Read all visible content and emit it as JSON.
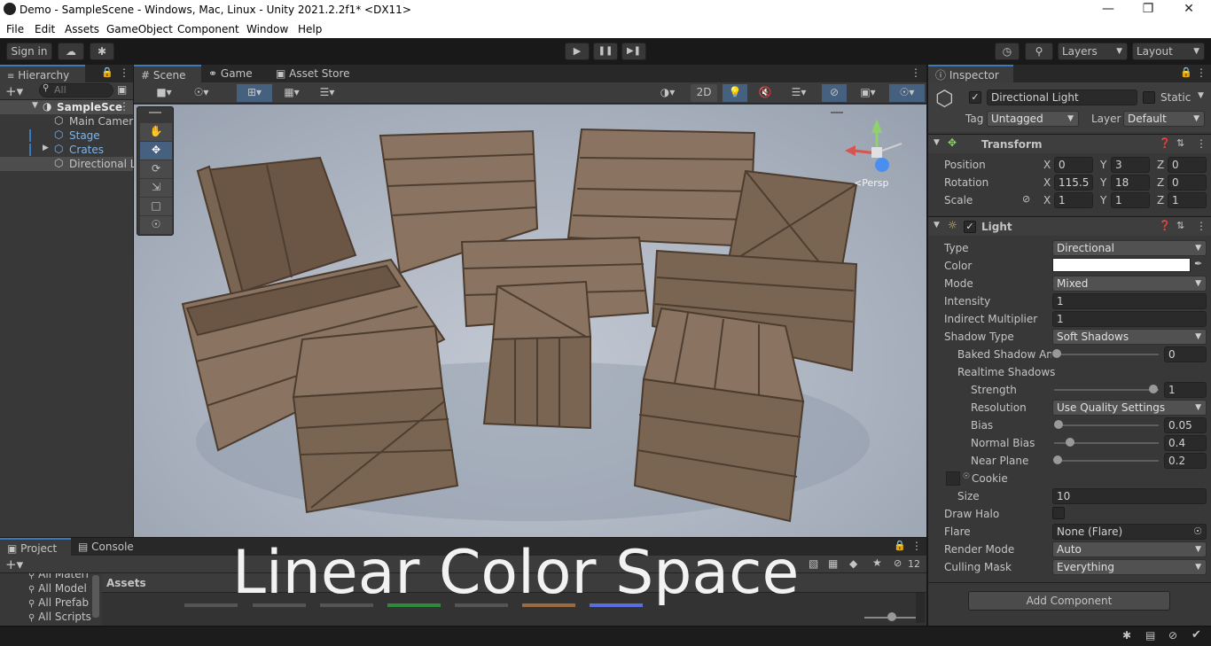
{
  "window": {
    "title": "Demo - SampleScene - Windows, Mac, Linux - Unity 2021.2.2f1* <DX11>"
  },
  "menu": [
    "File",
    "Edit",
    "Assets",
    "GameObject",
    "Component",
    "Window",
    "Help"
  ],
  "toolbar": {
    "sign_in": "Sign in",
    "layers": "Layers",
    "layout": "Layout"
  },
  "hierarchy": {
    "tab": "Hierarchy",
    "search_placeholder": "All",
    "items": [
      {
        "label": "SampleSce",
        "level": 0
      },
      {
        "label": "Main Camera",
        "level": 1
      },
      {
        "label": "Stage",
        "level": 1
      },
      {
        "label": "Crates",
        "level": 1
      },
      {
        "label": "Directional L",
        "level": 1
      }
    ]
  },
  "scene": {
    "tabs": [
      "Scene",
      "Game",
      "Asset Store"
    ],
    "btn_2d": "2D",
    "persp": "<Persp",
    "overlay_text": "Linear Color Space"
  },
  "project": {
    "tabs": [
      "Project",
      "Console"
    ],
    "badge_count": "12",
    "search_filters": [
      "All Materi",
      "All Model",
      "All Prefab",
      "All Scripts"
    ],
    "assets_header": "Assets"
  },
  "inspector": {
    "tab": "Inspector",
    "object_name": "Directional Light",
    "static_label": "Static",
    "tag_label": "Tag",
    "tag_value": "Untagged",
    "layer_label": "Layer",
    "layer_value": "Default",
    "transform": {
      "title": "Transform",
      "position_label": "Position",
      "rotation_label": "Rotation",
      "scale_label": "Scale",
      "position": {
        "x": "0",
        "y": "3",
        "z": "0"
      },
      "rotation": {
        "x": "115.5",
        "y": "18",
        "z": "0"
      },
      "scale": {
        "x": "1",
        "y": "1",
        "z": "1"
      }
    },
    "light": {
      "title": "Light",
      "type_label": "Type",
      "type_value": "Directional",
      "color_label": "Color",
      "mode_label": "Mode",
      "mode_value": "Mixed",
      "intensity_label": "Intensity",
      "intensity_value": "1",
      "indirect_label": "Indirect Multiplier",
      "indirect_value": "1",
      "shadow_type_label": "Shadow Type",
      "shadow_type_value": "Soft Shadows",
      "baked_label": "Baked Shadow An",
      "baked_value": "0",
      "realtime_label": "Realtime Shadows",
      "strength_label": "Strength",
      "strength_value": "1",
      "resolution_label": "Resolution",
      "resolution_value": "Use Quality Settings",
      "bias_label": "Bias",
      "bias_value": "0.05",
      "normal_bias_label": "Normal Bias",
      "normal_bias_value": "0.4",
      "near_plane_label": "Near Plane",
      "near_plane_value": "0.2",
      "cookie_label": "Cookie",
      "size_label": "Size",
      "size_value": "10",
      "draw_halo_label": "Draw Halo",
      "flare_label": "Flare",
      "flare_value": "None (Flare)",
      "render_mode_label": "Render Mode",
      "render_mode_value": "Auto",
      "culling_label": "Culling Mask",
      "culling_value": "Everything"
    },
    "add_component": "Add Component"
  },
  "colors": {
    "accent": "#3a79bb",
    "panel": "#383838",
    "header": "#282828",
    "scene_bg": "#aeb6c2"
  }
}
